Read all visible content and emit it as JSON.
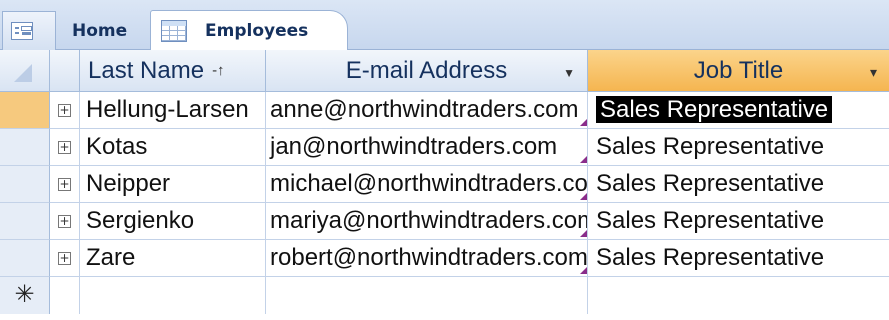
{
  "tabs": {
    "home_label": "Home",
    "employees_label": "Employees"
  },
  "columns": {
    "last_name": "Last Name",
    "email": "E-mail Address",
    "job_title": "Job Title"
  },
  "rows": [
    {
      "last_name": "Hellung-Larsen",
      "email": "anne@northwindtraders.com",
      "job_title": "Sales Representative"
    },
    {
      "last_name": "Kotas",
      "email": "jan@northwindtraders.com",
      "job_title": "Sales Representative"
    },
    {
      "last_name": "Neipper",
      "email": "michael@northwindtraders.com",
      "job_title": "Sales Representative"
    },
    {
      "last_name": "Sergienko",
      "email": "mariya@northwindtraders.com",
      "job_title": "Sales Representative"
    },
    {
      "last_name": "Zare",
      "email": "robert@northwindtraders.com",
      "job_title": "Sales Representative"
    }
  ],
  "glyphs": {
    "expand": "+",
    "new_record": "✳",
    "sort": "-↑",
    "dropdown": "▼",
    "filter": "▾"
  },
  "colors": {
    "selected_header": "#f5b550",
    "link_marker": "#8a2d8a"
  }
}
